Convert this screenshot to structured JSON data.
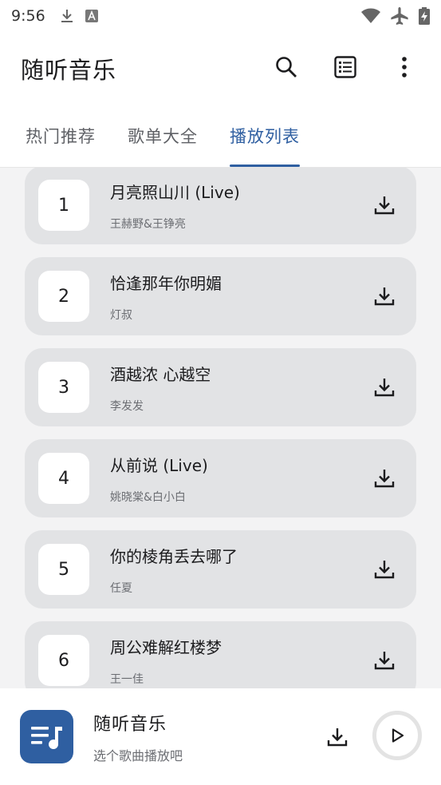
{
  "status_bar": {
    "time": "9:56",
    "left_icons": [
      "download-icon",
      "a-notification-icon"
    ],
    "right_icons": [
      "wifi-icon",
      "airplane-icon",
      "battery-charging-icon"
    ]
  },
  "app_bar": {
    "title": "随听音乐",
    "actions": [
      "search-icon",
      "list-view-icon",
      "more-vert-icon"
    ]
  },
  "tabs": [
    {
      "label": "热门推荐",
      "active": false
    },
    {
      "label": "歌单大全",
      "active": false
    },
    {
      "label": "播放列表",
      "active": true
    }
  ],
  "songs": [
    {
      "index": "1",
      "title": "月亮照山川 (Live)",
      "artist": "王赫野&王铮亮"
    },
    {
      "index": "2",
      "title": "恰逢那年你明媚",
      "artist": "灯叔"
    },
    {
      "index": "3",
      "title": "酒越浓 心越空",
      "artist": "李发发"
    },
    {
      "index": "4",
      "title": "从前说 (Live)",
      "artist": "姚晓棠&白小白"
    },
    {
      "index": "5",
      "title": "你的棱角丢去哪了",
      "artist": "任夏"
    },
    {
      "index": "6",
      "title": "周公难解红楼梦",
      "artist": "王一佳"
    }
  ],
  "player": {
    "title": "随听音乐",
    "subtitle": "选个歌曲播放吧"
  },
  "colors": {
    "accent": "#2f5fa1",
    "card": "#e2e3e5",
    "list_background": "#f3f3f4"
  }
}
